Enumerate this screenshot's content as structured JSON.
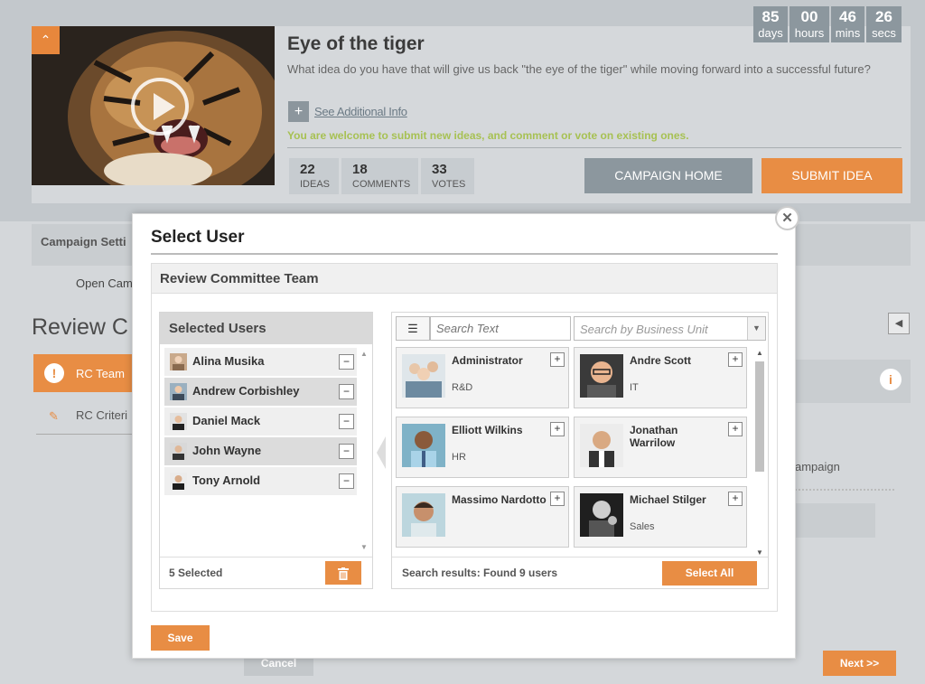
{
  "campaign": {
    "title": "Eye of the tiger",
    "description": "What idea do you have that will give us back \"the eye of the tiger\" while moving forward into a successful future?",
    "additional_info_link": "See Additional Info",
    "welcome_text": "You are welcome to submit new ideas, and comment or vote on existing ones.",
    "collapse_icon": "chevron-up-icon",
    "play_icon": "play-icon"
  },
  "countdown": [
    {
      "value": "85",
      "unit": "days"
    },
    {
      "value": "00",
      "unit": "hours"
    },
    {
      "value": "46",
      "unit": "mins"
    },
    {
      "value": "26",
      "unit": "secs"
    }
  ],
  "stats": [
    {
      "value": "22",
      "label": "IDEAS"
    },
    {
      "value": "18",
      "label": "COMMENTS"
    },
    {
      "value": "33",
      "label": "VOTES"
    }
  ],
  "actions": {
    "campaign_home": "CAMPAIGN HOME",
    "submit_idea": "SUBMIT IDEA"
  },
  "background": {
    "settings_label": "Campaign Setti",
    "open_campaign": "Open Cam",
    "review_heading": "Review C",
    "rc_team": "RC Team",
    "rc_criteria": "RC Criteri",
    "campaign_fragment": "ampaign",
    "cancel": "Cancel",
    "next": "Next >>"
  },
  "modal": {
    "title": "Select User",
    "team_heading": "Review Committee Team",
    "selected_heading": "Selected Users",
    "selected_users": [
      {
        "name": "Alina Musika"
      },
      {
        "name": "Andrew Corbishley"
      },
      {
        "name": "Daniel Mack"
      },
      {
        "name": "John Wayne"
      },
      {
        "name": "Tony Arnold"
      }
    ],
    "selected_count": "5 Selected",
    "search_placeholder": "Search Text",
    "business_unit_placeholder": "Search by Business Unit",
    "results": [
      {
        "name": "Administrator",
        "dept": "R&D"
      },
      {
        "name": "Andre Scott",
        "dept": "IT"
      },
      {
        "name": "Elliott Wilkins",
        "dept": "HR"
      },
      {
        "name": "Jonathan Warrilow",
        "dept": ""
      },
      {
        "name": "Massimo Nardotto",
        "dept": ""
      },
      {
        "name": "Michael Stilger",
        "dept": "Sales"
      }
    ],
    "results_text": "Search results: Found 9 users",
    "select_all": "Select All",
    "save": "Save",
    "close_icon": "close-icon"
  },
  "colors": {
    "accent": "#e88d44",
    "neutral_button": "#8c979e",
    "welcome_green": "#a7c153"
  }
}
